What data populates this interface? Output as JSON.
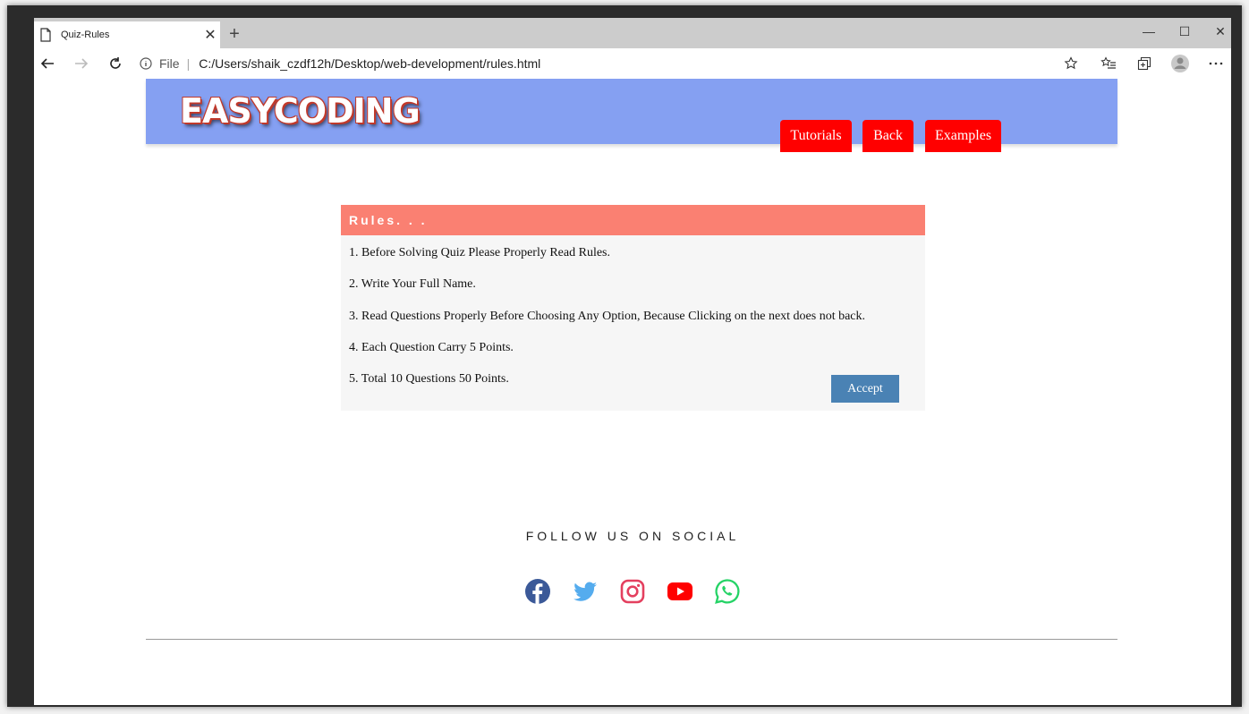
{
  "browser": {
    "tab_title": "Quiz-Rules",
    "tab_close": "✕",
    "new_tab": "+",
    "address_file_label": "File",
    "address_sep": "|",
    "url": "C:/Users/shaik_czdf12h/Desktop/web-development/rules.html",
    "window_controls": {
      "minimize": "—",
      "maximize": "☐",
      "close": "✕"
    }
  },
  "site": {
    "logo": "EASYCODING",
    "nav": [
      {
        "label": "Tutorials"
      },
      {
        "label": "Back"
      },
      {
        "label": "Examples"
      }
    ],
    "brand_colors": {
      "header": "#85a0f2",
      "nav": "#ff0000",
      "rules_head": "#fa8072",
      "accept": "#4a82b4"
    }
  },
  "rules": {
    "heading": "Rules. . .",
    "items": [
      "1. Before Solving Quiz Please Properly Read Rules.",
      "2. Write Your Full Name.",
      "3. Read Questions Properly Before Choosing Any Option, Because Clicking on the next does not back.",
      "4. Each Question Carry 5 Points.",
      "5. Total 10 Questions 50 Points."
    ],
    "accept_label": "Accept"
  },
  "footer": {
    "follow_text": "FOLLOW US ON SOCIAL",
    "social_icons": [
      "facebook-icon",
      "twitter-icon",
      "instagram-icon",
      "youtube-icon",
      "whatsapp-icon"
    ]
  }
}
